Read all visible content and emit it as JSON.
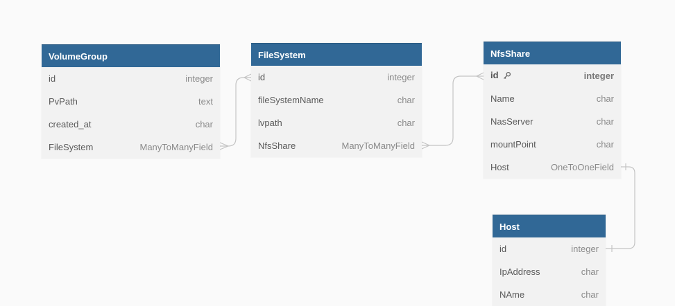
{
  "tables": [
    {
      "title": "VolumeGroup",
      "fields": [
        {
          "name": "id",
          "type": "integer"
        },
        {
          "name": "PvPath",
          "type": "text"
        },
        {
          "name": "created_at",
          "type": "char"
        },
        {
          "name": "FileSystem",
          "type": "ManyToManyField"
        }
      ]
    },
    {
      "title": "FileSystem",
      "fields": [
        {
          "name": "id",
          "type": "integer"
        },
        {
          "name": "fileSystemName",
          "type": "char"
        },
        {
          "name": "lvpath",
          "type": "char"
        },
        {
          "name": "NfsShare",
          "type": "ManyToManyField"
        }
      ]
    },
    {
      "title": "NfsShare",
      "fields": [
        {
          "name": "id",
          "type": "integer",
          "key_icon": "key-icon"
        },
        {
          "name": "Name",
          "type": "char"
        },
        {
          "name": "NasServer",
          "type": "char"
        },
        {
          "name": "mountPoint",
          "type": "char"
        },
        {
          "name": "Host",
          "type": "OneToOneField"
        }
      ]
    },
    {
      "title": "Host",
      "fields": [
        {
          "name": "id",
          "type": "integer"
        },
        {
          "name": "IpAddress",
          "type": "char"
        },
        {
          "name": "NAme",
          "type": "char"
        }
      ]
    }
  ],
  "relationships": [
    {
      "from": "VolumeGroup.FileSystem",
      "to": "FileSystem.id",
      "kind": "many-to-many"
    },
    {
      "from": "FileSystem.NfsShare",
      "to": "NfsShare.id",
      "kind": "many-to-many"
    },
    {
      "from": "NfsShare.Host",
      "to": "Host.id",
      "kind": "one-to-one"
    }
  ],
  "colors": {
    "header_bg": "#316896",
    "header_text": "#ffffff",
    "body_bg": "#f2f2f2",
    "connector": "#c4c4c4",
    "canvas_bg": "#fafafa"
  }
}
